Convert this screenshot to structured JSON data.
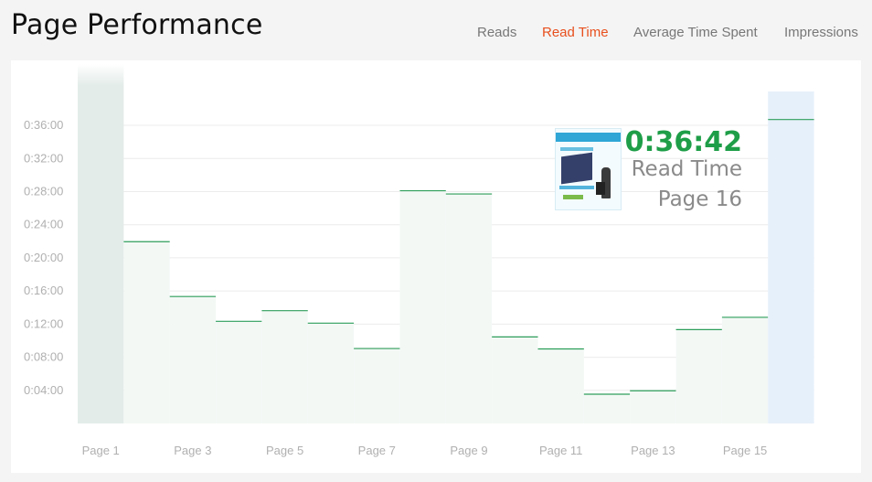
{
  "header": {
    "title": "Page Performance",
    "tabs": [
      {
        "label": "Reads",
        "active": false
      },
      {
        "label": "Read Time",
        "active": true
      },
      {
        "label": "Average Time Spent",
        "active": false
      },
      {
        "label": "Impressions",
        "active": false
      }
    ]
  },
  "callout": {
    "value": "0:36:42",
    "label": "Read Time",
    "page": "Page 16"
  },
  "colors": {
    "accent": "#e8501e",
    "value_green": "#1e9e48",
    "step_line": "#2e9e5a",
    "highlight_page": "#e6f0fa",
    "first_page": "#e3ece8"
  },
  "chart_data": {
    "type": "bar",
    "categories": [
      "Page 1",
      "Page 2",
      "Page 3",
      "Page 4",
      "Page 5",
      "Page 6",
      "Page 7",
      "Page 8",
      "Page 9",
      "Page 10",
      "Page 11",
      "Page 12",
      "Page 13",
      "Page 14",
      "Page 15",
      "Page 16"
    ],
    "tick_labels": [
      "Page 1",
      "Page 3",
      "Page 5",
      "Page 7",
      "Page 9",
      "Page 11",
      "Page 13",
      "Page 15"
    ],
    "values_seconds": [
      null,
      1317,
      920,
      740,
      817,
      727,
      543,
      1686,
      1663,
      627,
      540,
      212,
      237,
      680,
      769,
      2202
    ],
    "yticks": [
      "0:04:00",
      "0:08:00",
      "0:12:00",
      "0:16:00",
      "0:20:00",
      "0:24:00",
      "0:28:00",
      "0:32:00",
      "0:36:00"
    ],
    "ylim_seconds": [
      0,
      2400
    ],
    "selected": "Page 16"
  }
}
